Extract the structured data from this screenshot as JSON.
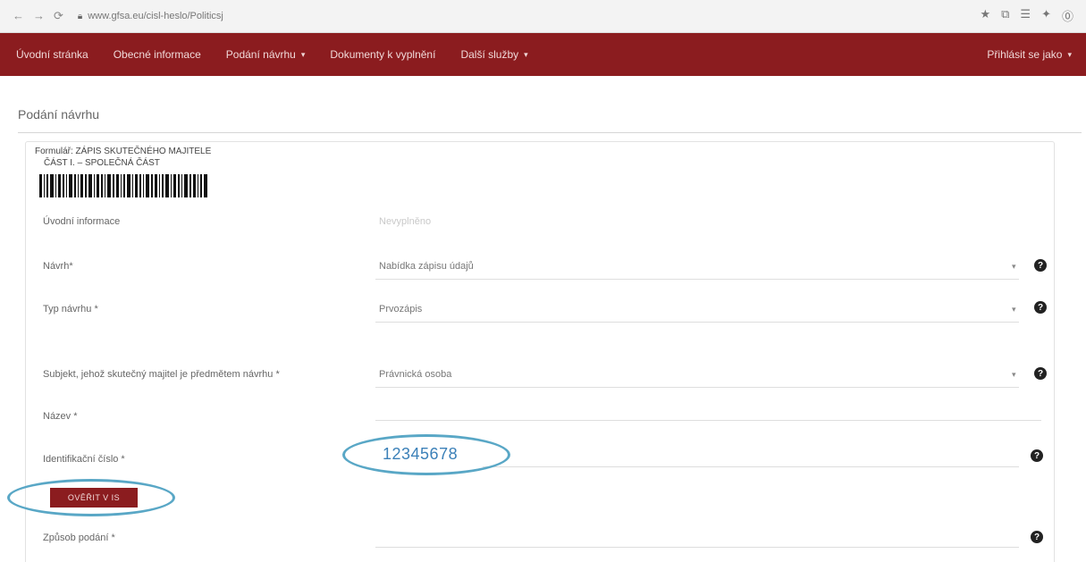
{
  "browser": {
    "nav": [
      "←",
      "→",
      "⟳"
    ],
    "url": "www.gfsa.eu/cisl-heslo/Politicsj",
    "right_icons": [
      "★",
      "⧉",
      "☰",
      "✦",
      "⓪"
    ]
  },
  "topnav": {
    "items": [
      {
        "label": "Úvodní stránka"
      },
      {
        "label": "Obecné informace"
      },
      {
        "label": "Podání návrhu",
        "caret": "▾"
      },
      {
        "label": "Dokumenty k vyplnění"
      },
      {
        "label": "Další služby",
        "caret": "▾"
      }
    ],
    "right": {
      "label": "Přihlásit se jako",
      "caret": "▾"
    }
  },
  "page": {
    "title": "Podání návrhu"
  },
  "form": {
    "header_line1": "Formulář: ZÁPIS SKUTEČNÉHO MAJITELE",
    "header_line2": "ČÁST I. – SPOLEČNÁ ČÁST",
    "fields": [
      {
        "label": "Úvodní informace",
        "value": "Nevyplněno"
      },
      {
        "label": "Návrh*",
        "value": "Nabídka zápisu údajů",
        "has_caret": true
      },
      {
        "label": "Typ návrhu *",
        "value": "Prvozápis",
        "has_caret": true
      },
      {
        "label": "Subjekt, jehož skutečný majitel je předmětem návrhu *",
        "value": "Právnická osoba",
        "has_caret": true
      },
      {
        "label": "Název *",
        "value": ""
      },
      {
        "label": "Identifikační číslo *",
        "value": "12345678"
      },
      {
        "label": "Způsob podání *",
        "value": ""
      }
    ],
    "verify_button": "OVĚŘIT V IS",
    "help_glyph": "?",
    "caret_glyph": "▾"
  },
  "colors": {
    "brand": "#8b1c1f",
    "highlight": "#59a7c6",
    "id_value": "#3b80b8"
  }
}
